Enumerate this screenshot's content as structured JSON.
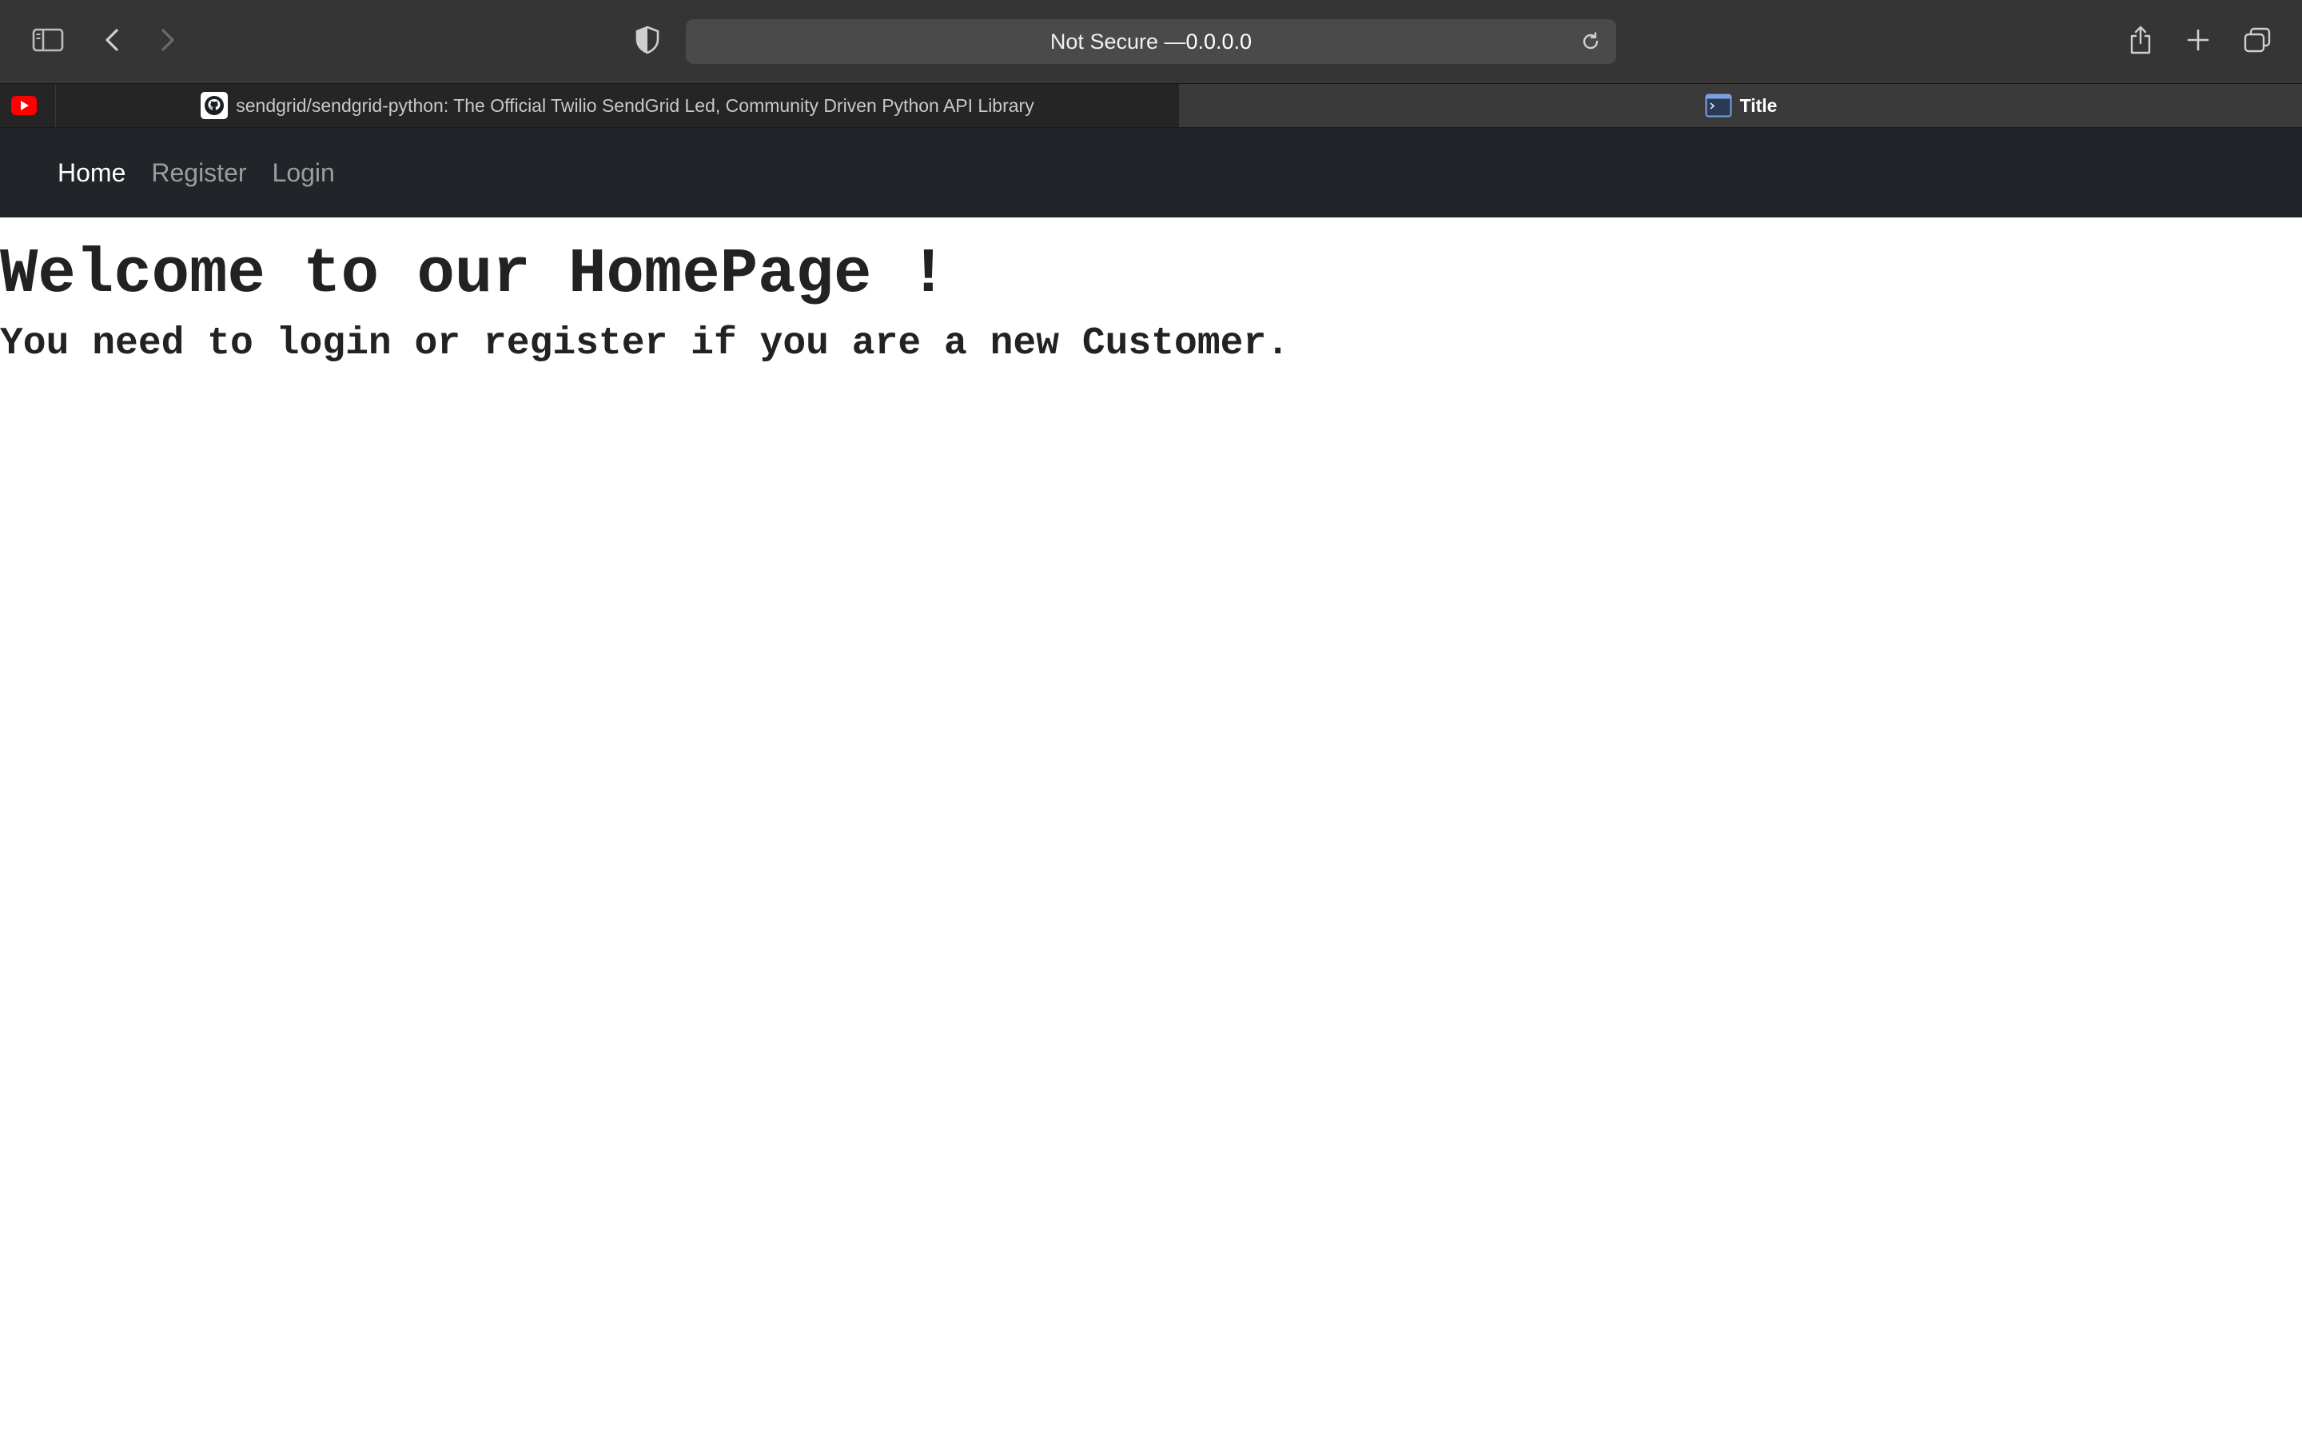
{
  "browser": {
    "url_prefix": "Not Secure — ",
    "url_host": "0.0.0.0",
    "tabs": [
      {
        "label": "",
        "icon": "youtube-icon"
      },
      {
        "label": "sendgrid/sendgrid-python: The Official Twilio SendGrid Led, Community Driven Python API Library",
        "icon": "github-icon"
      },
      {
        "label": "Title",
        "icon": "terminal-page-icon"
      }
    ]
  },
  "navbar": {
    "links": [
      "Home",
      "Register",
      "Login"
    ],
    "active": "Home"
  },
  "page": {
    "heading": "Welcome to our HomePage !",
    "subheading": "You need to login or register if you are a new Customer."
  },
  "colors": {
    "navbar_bg": "#212529",
    "toolbar_bg": "#353535",
    "text_dark": "#222222"
  }
}
